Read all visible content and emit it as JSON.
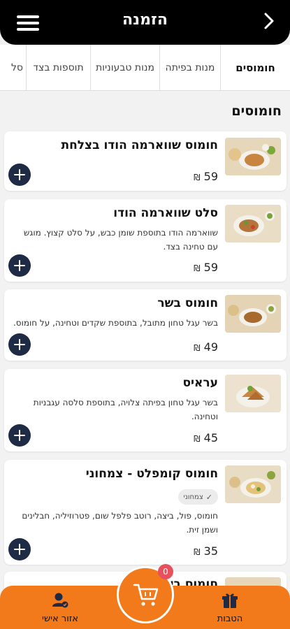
{
  "header": {
    "title": "הזמנה"
  },
  "tabs": [
    {
      "label": "חומוסים"
    },
    {
      "label": "מנות בפיתה"
    },
    {
      "label": "מנות טבעוניות"
    },
    {
      "label": "תוספות בצד"
    },
    {
      "label": "סל"
    }
  ],
  "section_title": "חומוסים",
  "items": [
    {
      "name": "חומוס שווארמה הודו בצלחת",
      "description": "",
      "price": "59",
      "currency": "₪"
    },
    {
      "name": "סלט שווארמה הודו",
      "description": "שווארמה הודו בתוספת שומן כבש, על סלט קצוץ. מוגש עם טחינה בצד.",
      "price": "59",
      "currency": "₪"
    },
    {
      "name": "חומוס בשר",
      "description": "בשר עגל טחון מתובל, בתוספת שקדים וטחינה, על חומוס.",
      "price": "49",
      "currency": "₪"
    },
    {
      "name": "עראיס",
      "description": "בשר עגל טחון בפיתה צלויה, בתוספת סלסה עגבניות וטחינה.",
      "price": "45",
      "currency": "₪"
    },
    {
      "name": "חומוס קומפלט - צמחוני",
      "badge": "צמחוני",
      "description": "חומוס, פול, ביצה, רוטב פלפל שום, פטרוזיליה, חבלינים ושמן זית.",
      "price": "35",
      "currency": "₪"
    },
    {
      "name": "חומוס ביצה"
    }
  ],
  "bottom_nav": {
    "left_label": "אזור אישי",
    "right_label": "הטבות",
    "cart_count": "0"
  },
  "colors": {
    "accent": "#f27a1a",
    "header": "#000000",
    "add_button": "#1f2a44",
    "badge": "#e8505b"
  }
}
